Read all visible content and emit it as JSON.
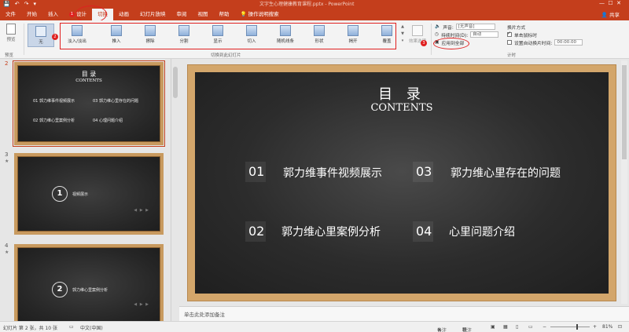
{
  "window": {
    "title": "文字生心理健康教育课程.pptx  -  PowerPoint",
    "share": "共享"
  },
  "qat": {
    "save": "💾",
    "undo": "↶",
    "redo": "↷",
    "more": "▾"
  },
  "tabs": [
    "文件",
    "开始",
    "插入",
    "设计",
    "切换",
    "动画",
    "幻灯片放映",
    "审阅",
    "视图",
    "帮助"
  ],
  "tell_me": "操作说明搜索",
  "annotations": {
    "one": "1",
    "two": "2",
    "three": "3"
  },
  "ribbon": {
    "preview": "预览",
    "preview_group": "预览",
    "transitions_group": "切换到此幻灯片",
    "timing_group": "计时",
    "effect_options": "效果选项",
    "transitions": [
      "无",
      "淡入/淡出",
      "推入",
      "擦除",
      "分割",
      "显示",
      "切入",
      "随机线条",
      "形状",
      "揭开",
      "覆盖"
    ],
    "sound_label": "声音:",
    "sound_value": "[无声音]",
    "duration_label": "持续时间(D):",
    "duration_value": "自动",
    "apply_all": "应用到全部",
    "advance_label": "换片方式",
    "on_click": "单击鼠标时",
    "after_label": "设置自动换片时间:",
    "after_value": "00:00.00"
  },
  "thumbnails": [
    {
      "num": "2",
      "title": "目 录",
      "subtitle": "CONTENTS",
      "items": [
        "01  郭力维事件视频展示",
        "03  郭力维心里存在的问题",
        "02  郭力维心里案例分析",
        "04  心理问题介绍"
      ]
    },
    {
      "num": "3",
      "circle": "1",
      "label": "视频展示",
      "arrows": "◀ ▶ ▶"
    },
    {
      "num": "4",
      "circle": "2",
      "label": "郭力维心里案例分析",
      "arrows": "◀ ▶ ▶"
    }
  ],
  "slide": {
    "title": "目 录",
    "subtitle": "CONTENTS",
    "items": [
      {
        "num": "01",
        "text": "郭力维事件视频展示"
      },
      {
        "num": "03",
        "text": "郭力维心里存在的问题"
      },
      {
        "num": "02",
        "text": "郭力维心里案例分析"
      },
      {
        "num": "04",
        "text": "心里问题介绍"
      }
    ]
  },
  "notes_placeholder": "单击此处添加备注",
  "status": {
    "slide_info": "幻灯片 第 2 张，共 10 张",
    "language": "中文(中国)",
    "notes": "备注",
    "comments": "批注",
    "zoom": "81%"
  },
  "colors": {
    "accent": "#c43e1c",
    "highlight": "#e02020",
    "frame": "#d3a66b",
    "board": "#262626"
  }
}
